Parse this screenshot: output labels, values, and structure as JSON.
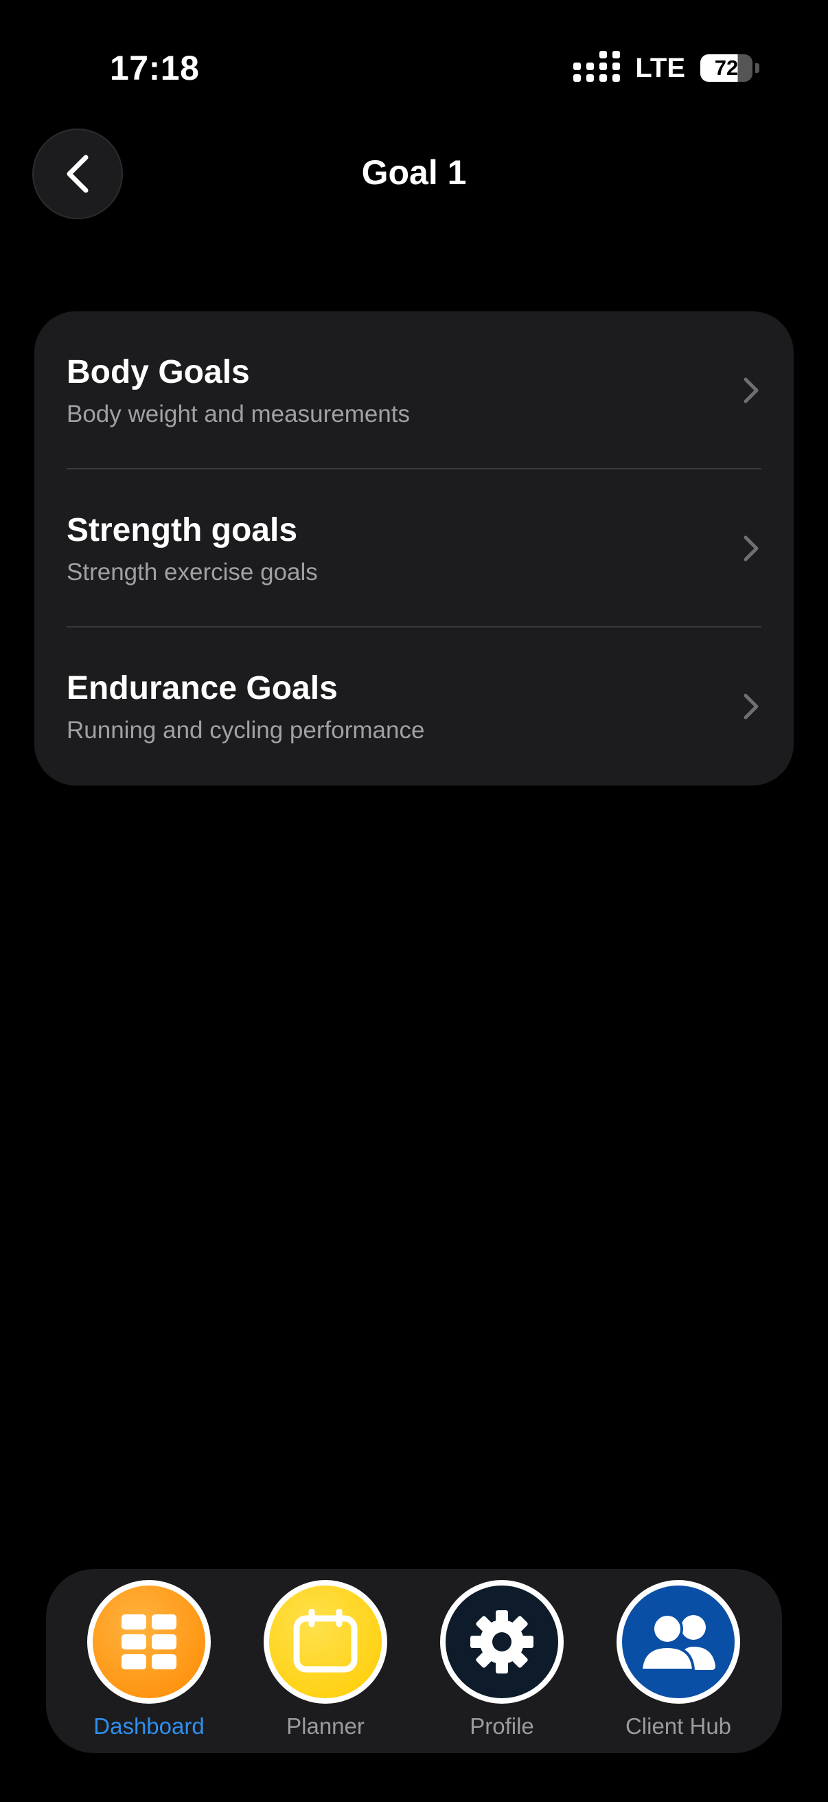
{
  "status_bar": {
    "time": "17:18",
    "network": "LTE",
    "battery": "72"
  },
  "header": {
    "back_icon": "chevron-left-icon",
    "title": "Goal 1"
  },
  "goals": [
    {
      "title": "Body Goals",
      "subtitle": "Body weight and measurements"
    },
    {
      "title": "Strength goals",
      "subtitle": "Strength exercise goals"
    },
    {
      "title": "Endurance Goals",
      "subtitle": "Running and cycling performance"
    }
  ],
  "tabbar": {
    "tabs": [
      {
        "label": "Dashboard",
        "icon": "grid-icon",
        "color": "#ff9f0a",
        "active": true
      },
      {
        "label": "Planner",
        "icon": "calendar-icon",
        "color": "#ffd60a",
        "active": false
      },
      {
        "label": "Profile",
        "icon": "gear-icon",
        "color": "#0d1b2a",
        "active": false
      },
      {
        "label": "Client Hub",
        "icon": "users-icon",
        "color": "#0a4fa6",
        "active": false
      }
    ]
  },
  "colors": {
    "background": "#000000",
    "card": "#1c1c1e",
    "accent": "#2f8ff0"
  }
}
